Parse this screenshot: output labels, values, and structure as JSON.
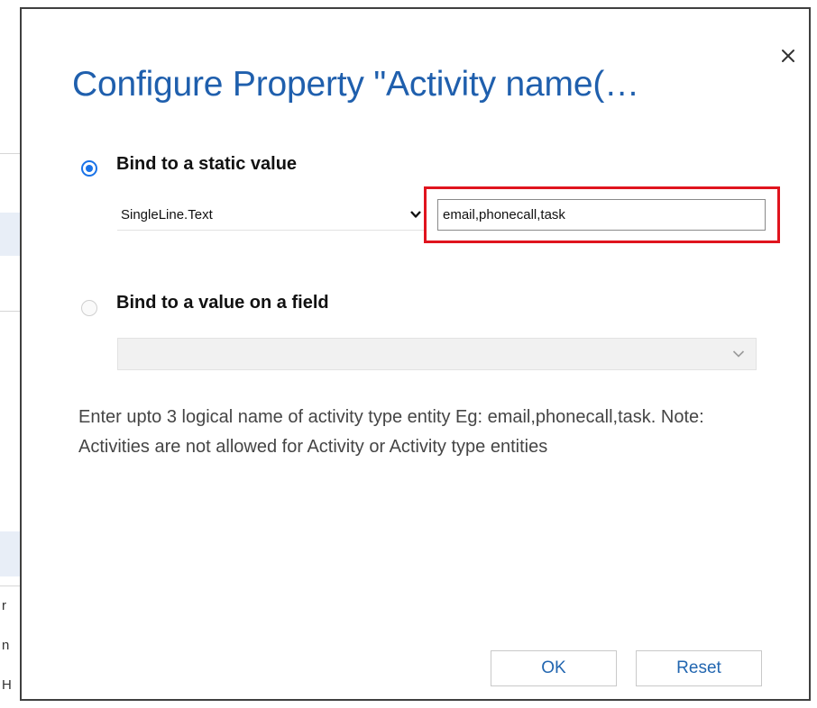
{
  "dialog": {
    "title": "Configure Property \"Activity name(…",
    "close_icon": "close-icon",
    "static_option": {
      "label": "Bind to a static value",
      "selected": true,
      "type_select_value": "SingleLine.Text",
      "value_input": "email,phonecall,task"
    },
    "field_option": {
      "label": "Bind to a value on a field",
      "selected": false,
      "field_select_value": ""
    },
    "description": "Enter upto 3 logical name of activity type entity Eg: email,phonecall,task. Note: Activities are not allowed for Activity or Activity type entities",
    "buttons": {
      "ok": "OK",
      "reset": "Reset"
    }
  },
  "background": {
    "fragments": [
      "r",
      "n",
      "H"
    ]
  },
  "colors": {
    "title": "#1f5fad",
    "radio_selected": "#1a73e8",
    "highlight": "#e0141e",
    "button_text": "#2266b0"
  }
}
